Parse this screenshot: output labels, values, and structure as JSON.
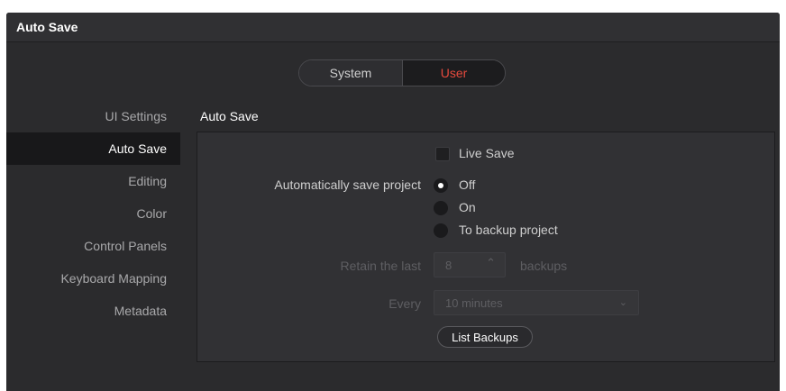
{
  "window": {
    "title": "Auto Save"
  },
  "scope_toggle": {
    "options": [
      "System",
      "User"
    ],
    "selected": "User"
  },
  "sidebar": {
    "items": [
      {
        "label": "UI Settings",
        "active": false
      },
      {
        "label": "Auto Save",
        "active": true
      },
      {
        "label": "Editing",
        "active": false
      },
      {
        "label": "Color",
        "active": false
      },
      {
        "label": "Control Panels",
        "active": false
      },
      {
        "label": "Keyboard Mapping",
        "active": false
      },
      {
        "label": "Metadata",
        "active": false
      }
    ]
  },
  "panel": {
    "title": "Auto Save",
    "live_save": {
      "label": "Live Save",
      "checked": false
    },
    "auto_save": {
      "label": "Automatically save project",
      "options": [
        {
          "label": "Off",
          "selected": true
        },
        {
          "label": "On",
          "selected": false
        },
        {
          "label": "To backup project",
          "selected": false
        }
      ]
    },
    "retain": {
      "label": "Retain the last",
      "value": "8",
      "suffix": "backups"
    },
    "every": {
      "label": "Every",
      "value": "10 minutes"
    },
    "list_backups_button": "List Backups"
  },
  "colors": {
    "accent_selected": "#e64a3d",
    "background": "#2b2b2d",
    "panel": "#313134"
  },
  "icons": {
    "stepper": "up-down-stepper-icon",
    "dropdown": "chevron-down-icon"
  }
}
